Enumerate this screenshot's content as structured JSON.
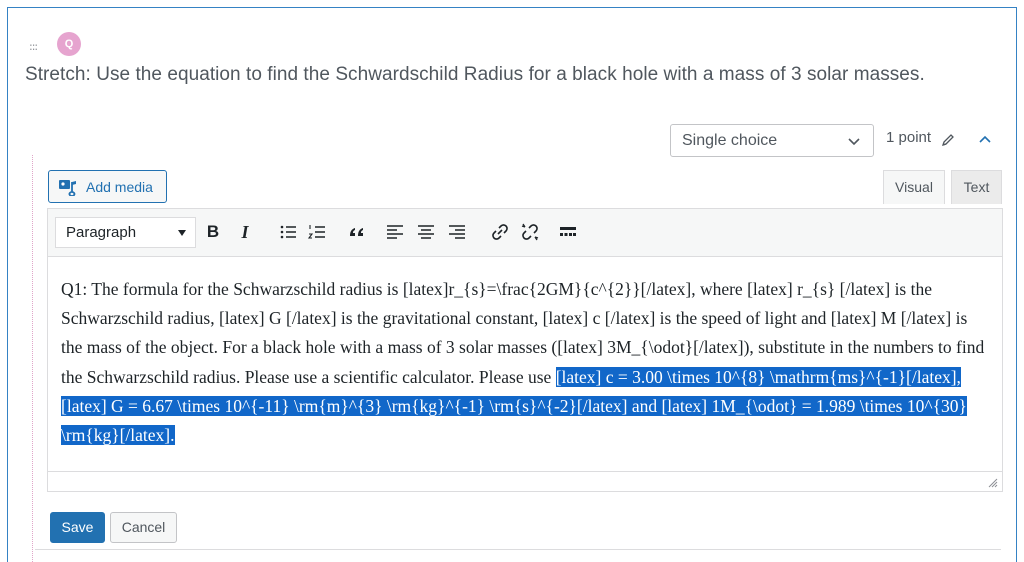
{
  "question": {
    "badge": "Q",
    "drag_glyph": ":::",
    "title": "Stretch: Use the equation to find the Schwardschild Radius for a black hole with a mass of 3 solar masses.",
    "type_select": "Single choice",
    "points": "1 point"
  },
  "editor": {
    "add_media_label": "Add media",
    "tabs": {
      "visual": "Visual",
      "text": "Text"
    },
    "format_select": "Paragraph",
    "toolbar_buttons": [
      {
        "name": "bold-button",
        "glyph": "B"
      },
      {
        "name": "italic-button",
        "glyph": "I"
      },
      {
        "name": "bulleted-list-button",
        "icon": "bulleted-list-icon"
      },
      {
        "name": "numbered-list-button",
        "icon": "numbered-list-icon"
      },
      {
        "name": "blockquote-button",
        "icon": "blockquote-icon"
      },
      {
        "name": "align-left-button",
        "icon": "align-left-icon"
      },
      {
        "name": "align-center-button",
        "icon": "align-center-icon"
      },
      {
        "name": "align-right-button",
        "icon": "align-right-icon"
      },
      {
        "name": "insert-link-button",
        "icon": "link-icon"
      },
      {
        "name": "remove-link-button",
        "icon": "unlink-icon"
      },
      {
        "name": "toolbar-toggle-button",
        "icon": "kitchen-sink-icon"
      }
    ],
    "body_text": "Q1: The formula for the Schwarzschild radius is [latex]r_{s}=\\frac{2GM}{c^{2}}[/latex], where [latex] r_{s} [/latex] is the Schwarzschild radius, [latex] G [/latex] is the gravitational constant, [latex] c [/latex] is the speed of light and [latex] M [/latex] is the mass of the object. For a black hole with a mass of 3 solar masses ([latex] 3M_{\\odot}[/latex]), substitute in the numbers to find the Schwarzschild radius. Please use a scientific calculator. Please use ",
    "selected_text": "[latex] c = 3.00 \\times 10^{8} \\mathrm{ms}^{-1}[/latex], [latex] G = 6.67 \\times 10^{-11} \\rm{m}^{3} \\rm{kg}^{-1} \\rm{s}^{-2}[/latex] and [latex] 1M_{\\odot} = 1.989 \\times 10^{30} \\rm{kg}[/latex]."
  },
  "actions": {
    "save": "Save",
    "cancel": "Cancel"
  },
  "colors": {
    "accent": "#2271b1",
    "selection": "#1167c9",
    "badge": "#e6a4cf"
  }
}
